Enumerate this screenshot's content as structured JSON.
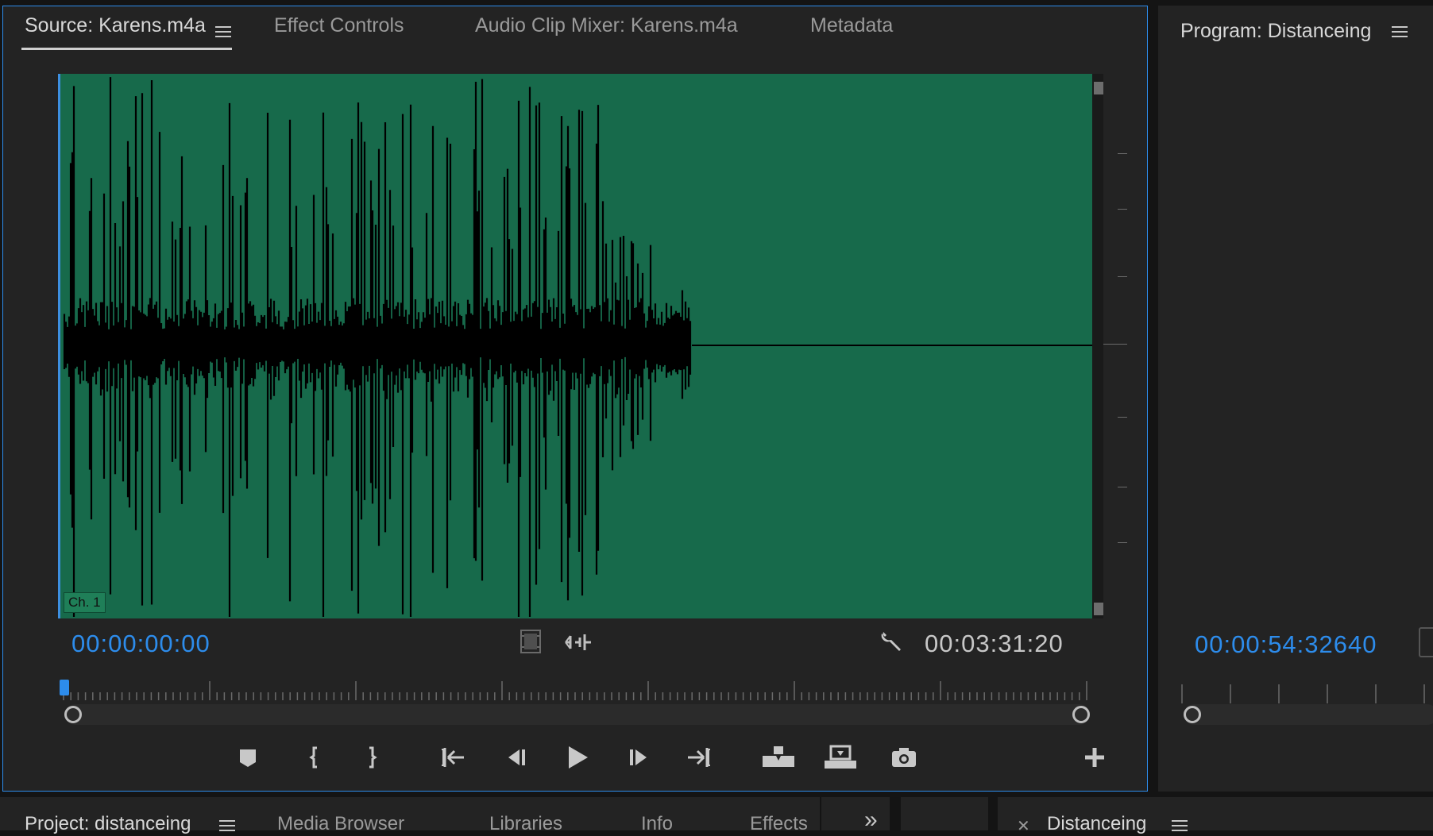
{
  "source_panel": {
    "tabs": [
      {
        "label": "Source: Karens.m4a",
        "active": true
      },
      {
        "label": "Effect Controls"
      },
      {
        "label": "Audio Clip Mixer: Karens.m4a"
      },
      {
        "label": "Metadata"
      }
    ],
    "channel_label": "Ch. 1",
    "timecode_in": "00:00:00:00",
    "timecode_duration": "00:03:31:20",
    "waveform_color": "#176a4b",
    "accent_color": "#2d8ceb",
    "playhead_position": 0.0,
    "icons": {
      "menu": "hamburger-menu-icon",
      "drag_video": "drag-video-only-icon",
      "drag_audio": "drag-audio-only-icon",
      "settings": "wrench-icon"
    },
    "transport": [
      {
        "name": "add-marker-button",
        "icon": "marker-icon"
      },
      {
        "name": "mark-in-button",
        "icon": "mark-in-icon"
      },
      {
        "name": "mark-out-button",
        "icon": "mark-out-icon"
      },
      {
        "name": "go-to-in-button",
        "icon": "go-to-in-icon"
      },
      {
        "name": "step-back-button",
        "icon": "step-back-icon"
      },
      {
        "name": "play-button",
        "icon": "play-icon"
      },
      {
        "name": "step-forward-button",
        "icon": "step-forward-icon"
      },
      {
        "name": "go-to-out-button",
        "icon": "go-to-out-icon"
      },
      {
        "name": "insert-button",
        "icon": "insert-icon"
      },
      {
        "name": "overwrite-button",
        "icon": "overwrite-icon"
      },
      {
        "name": "export-frame-button",
        "icon": "camera-icon"
      },
      {
        "name": "button-editor-button",
        "icon": "plus-icon"
      }
    ]
  },
  "program_panel": {
    "tab_label": "Program: Distanceing",
    "timecode": "00:00:54:32640"
  },
  "bottom_tabs": [
    {
      "label": "Project: distanceing"
    },
    {
      "label": "Media Browser"
    },
    {
      "label": "Libraries"
    },
    {
      "label": "Info"
    },
    {
      "label": "Effects"
    },
    {
      "label": "»"
    },
    {
      "label": "Distanceing"
    }
  ]
}
